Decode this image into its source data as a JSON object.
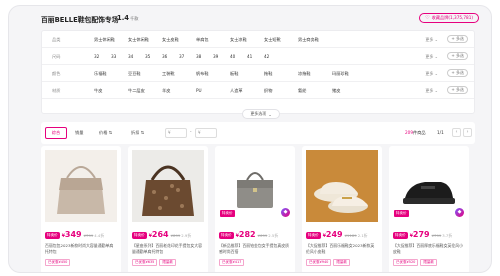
{
  "store": {
    "name": "百丽BELLE鞋包配饰专场",
    "count": "1.4",
    "count_unit": "千款",
    "fav_label": "收藏品牌(1,375,781)"
  },
  "filters": [
    {
      "label": "品类",
      "options": [
        "男士休闲鞋",
        "女士休闲鞋",
        "女士皮鞋",
        "单肩包",
        "女士凉鞋",
        "女士短靴",
        "男士商务鞋"
      ],
      "more": "更多",
      "multi": "+ 多选"
    },
    {
      "label": "尺码",
      "options": [
        "32",
        "33",
        "34",
        "35",
        "36",
        "37",
        "38",
        "39",
        "40",
        "41",
        "42"
      ],
      "more": "更多",
      "multi": "+ 多选"
    },
    {
      "label": "颜色",
      "options": [
        "乐福鞋",
        "豆豆鞋",
        "工装靴",
        "帆布鞋",
        "板鞋",
        "拖鞋",
        "凉拖鞋",
        "玛丽珍鞋"
      ],
      "more": "更多",
      "multi": "+ 多选"
    },
    {
      "label": "材质",
      "options": [
        "牛皮",
        "牛二层皮",
        "羊皮",
        "PU",
        "人造革",
        "织物",
        "氨纶",
        "猪皮"
      ],
      "more": "更多",
      "multi": "+ 多选"
    }
  ],
  "collapse_label": "更多选项",
  "sort": {
    "default": "综合",
    "sales": "销量",
    "price": "价格",
    "discount": "折扣",
    "price_min": "¥",
    "price_max": "¥",
    "result_num": "209",
    "result_suffix": "件商品",
    "page": "1/1",
    "prev": "‹",
    "next": "›"
  },
  "products": [
    {
      "tag": "特卖价",
      "price": "349",
      "orig": "¥799",
      "disc": "4.4折",
      "corner": "",
      "desc": "百丽包包2023新款时尚大容量通勤单肩托特包",
      "badges": [
        "已优惠¥450"
      ],
      "img": "tote"
    },
    {
      "tag": "特卖价",
      "price": "264",
      "orig": "¥899",
      "disc": "2.9折",
      "corner": "",
      "desc": "【星座系列】百丽老花印花手提包女大容量通勤单肩托特包",
      "badges": [
        "已优惠¥635",
        "限量款"
      ],
      "img": "brown"
    },
    {
      "tag": "特卖价",
      "price": "282",
      "orig": "¥699",
      "disc": "2.5折",
      "corner": "特卖价",
      "desc": "【新品推荐】百丽铂金包女手提包真皮质感时尚百搭",
      "badges": [
        "已优惠¥417"
      ],
      "img": "grey"
    },
    {
      "tag": "特卖价",
      "price": "249",
      "orig": "¥1189",
      "disc": "2.1折",
      "corner": "",
      "desc": "【大促推荐】百丽乐福鞋女2023新款英伦风小皮鞋",
      "badges": [
        "已优惠¥940",
        "限量款"
      ],
      "img": "loafer"
    },
    {
      "tag": "特卖价",
      "price": "279",
      "orig": "¥799",
      "disc": "3.7折",
      "corner": "特卖价",
      "desc": "【大促推荐】百丽厚底乐福鞋女英伦风小皮鞋",
      "badges": [
        "已优惠¥520",
        "限量款"
      ],
      "img": "black"
    }
  ]
}
